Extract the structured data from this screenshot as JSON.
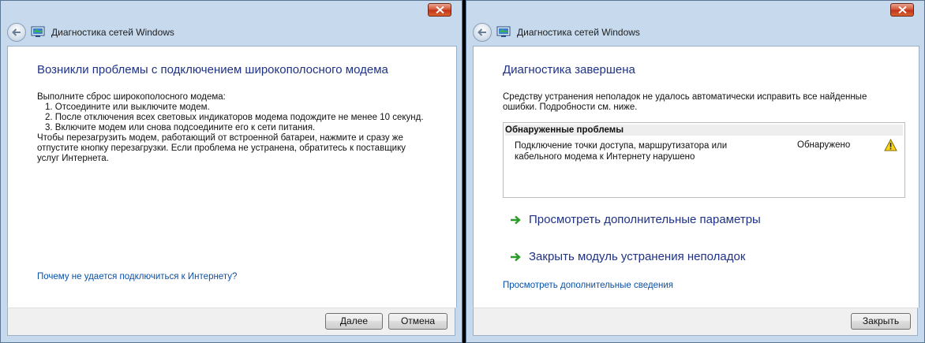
{
  "left_window": {
    "title": "Диагностика сетей Windows",
    "heading": "Возникли проблемы с подключением широкополосного модема",
    "intro": "Выполните сброс широкополосного модема:",
    "steps": [
      "1.  Отсоедините или выключите модем.",
      "2.  После отключения всех световых индикаторов модема подождите не менее 10 секунд.",
      "3.  Включите модем или снова подсоедините его к сети питания."
    ],
    "note_lines": [
      "Чтобы перезагрузить модем, работающий от встроенной батареи, нажмите и сразу же",
      "отпустите кнопку перезагрузки. Если проблема не устранена, обратитесь к поставщику",
      "услуг Интернета."
    ],
    "help_link": "Почему не удается подключиться к Интернету?",
    "next_button": {
      "underlined": "Д",
      "rest": "алее"
    },
    "cancel_button": "Отмена"
  },
  "right_window": {
    "title": "Диагностика сетей Windows",
    "heading": "Диагностика завершена",
    "summary_lines": [
      "Средству устранения неполадок не удалось автоматически исправить все найденные",
      "ошибки. Подробности см. ниже."
    ],
    "problems_title": "Обнаруженные проблемы",
    "problem": {
      "desc_lines": [
        "Подключение точки доступа, маршрутизатора или",
        "кабельного модема к Интернету нарушено"
      ],
      "status": "Обнаружено",
      "icon": "warning-icon"
    },
    "options": [
      {
        "label": "Просмотреть дополнительные параметры",
        "icon": "green-arrow-icon"
      },
      {
        "label": "Закрыть модуль устранения неполадок",
        "icon": "green-arrow-icon"
      }
    ],
    "details_link": "Просмотреть дополнительные сведения",
    "close_button": "Закрыть"
  },
  "colors": {
    "frame": "#c7d9ec",
    "heading": "#1e3287",
    "link": "#0a50a8",
    "close_red": "#c2361a"
  }
}
